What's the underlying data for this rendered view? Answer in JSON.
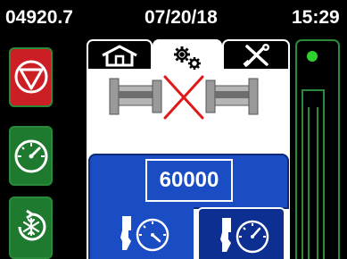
{
  "status_bar": {
    "counter": "04920.7",
    "date": "07/20/18",
    "time": "15:29"
  },
  "sidebar": {
    "items": [
      {
        "name": "stop",
        "icon": "stop-icon",
        "color": "#cc1f25"
      },
      {
        "name": "gauge",
        "icon": "gauge-icon",
        "color": "#1e7a2e"
      },
      {
        "name": "defrost",
        "icon": "defrost-icon",
        "color": "#1e7a2e"
      }
    ]
  },
  "tabs": [
    {
      "name": "home",
      "icon": "home-icon",
      "active": false
    },
    {
      "name": "settings",
      "icon": "gears-icon",
      "active": true
    },
    {
      "name": "tools",
      "icon": "tools-icon",
      "active": false
    }
  ],
  "main": {
    "status_image": "coupling-disconnected-icon",
    "value": "60000",
    "buttons": [
      {
        "name": "mode-left",
        "icon": "sensor-gauge-icon",
        "selected": false
      },
      {
        "name": "mode-right",
        "icon": "sensor-gauge-icon",
        "selected": true
      }
    ]
  },
  "gauge": {
    "indicator_color": "#2ed12e"
  },
  "colors": {
    "accent_blue": "#1a4cc4",
    "stop_red": "#cc1f25",
    "ok_green": "#1e7a2e"
  }
}
